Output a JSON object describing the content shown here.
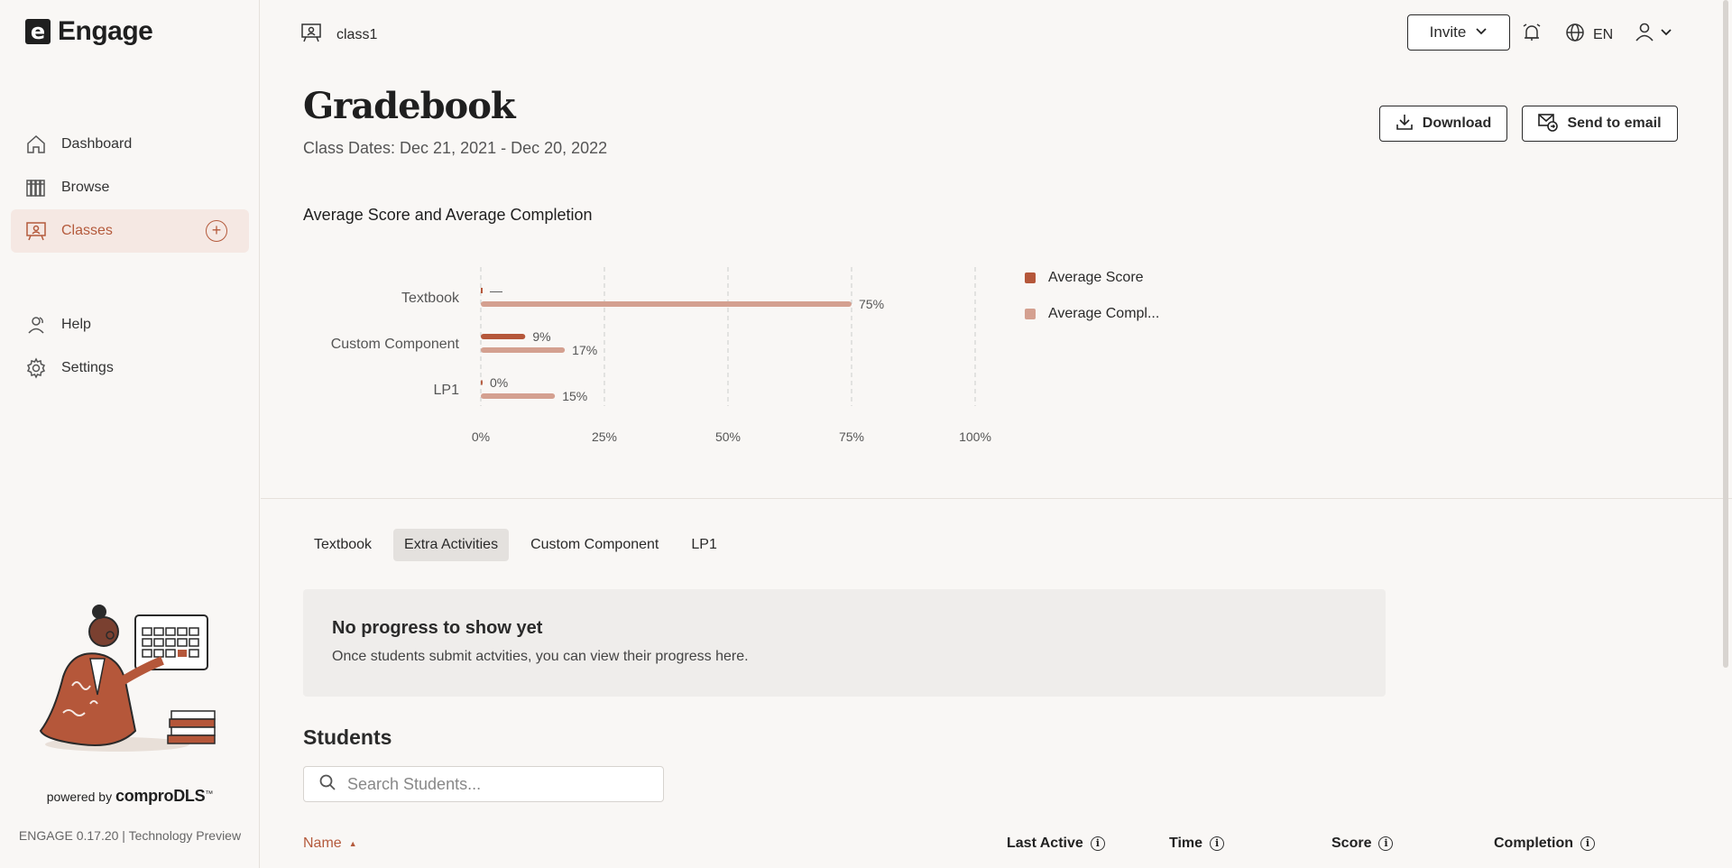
{
  "app": {
    "logo_letter": "e",
    "name": "Engage"
  },
  "sidebar": {
    "items": [
      {
        "label": "Dashboard",
        "icon": "home-icon"
      },
      {
        "label": "Browse",
        "icon": "books-icon"
      },
      {
        "label": "Classes",
        "icon": "classroom-icon",
        "active": true,
        "add": "+"
      },
      {
        "label": "Help",
        "icon": "help-icon"
      },
      {
        "label": "Settings",
        "icon": "gear-icon"
      }
    ],
    "powered_by": "powered by",
    "brand": "comproDLS",
    "tm": "™",
    "version": "ENGAGE 0.17.20 | Technology Preview"
  },
  "topbar": {
    "class_name": "class1",
    "invite_label": "Invite",
    "lang": "EN"
  },
  "header": {
    "title": "Gradebook",
    "class_dates": "Class Dates: Dec 21, 2021 - Dec 20, 2022",
    "download_label": "Download",
    "email_label": "Send to email"
  },
  "colors": {
    "accent": "#b45a3c",
    "score": "#b5573a",
    "completion": "#d4a090"
  },
  "chart_data": {
    "type": "bar",
    "orientation": "horizontal",
    "title": "Average Score and Average Completion",
    "categories": [
      "Textbook",
      "Custom Component",
      "LP1"
    ],
    "series": [
      {
        "name": "Average Score",
        "values": [
          null,
          9,
          0
        ],
        "labels": [
          "—",
          "9%",
          "0%"
        ],
        "color": "#b5573a"
      },
      {
        "name": "Average Compl...",
        "values": [
          75,
          17,
          15
        ],
        "labels": [
          "75%",
          "17%",
          "15%"
        ],
        "color": "#d4a090"
      }
    ],
    "x_ticks": [
      "0%",
      "25%",
      "50%",
      "75%",
      "100%"
    ],
    "xlim": [
      0,
      100
    ],
    "grid": "vertical dashed",
    "legend": "right"
  },
  "tabs": [
    {
      "label": "Textbook"
    },
    {
      "label": "Extra Activities",
      "active": true
    },
    {
      "label": "Custom Component"
    },
    {
      "label": "LP1"
    }
  ],
  "empty_state": {
    "title": "No progress to show yet",
    "desc": "Once students submit actvities, you can view their progress here."
  },
  "students": {
    "title": "Students",
    "search_placeholder": "Search Students...",
    "columns": {
      "name": "Name",
      "sort_indicator": "▲",
      "last_active": "Last Active",
      "time": "Time",
      "score": "Score",
      "completion": "Completion",
      "info": "i"
    }
  }
}
